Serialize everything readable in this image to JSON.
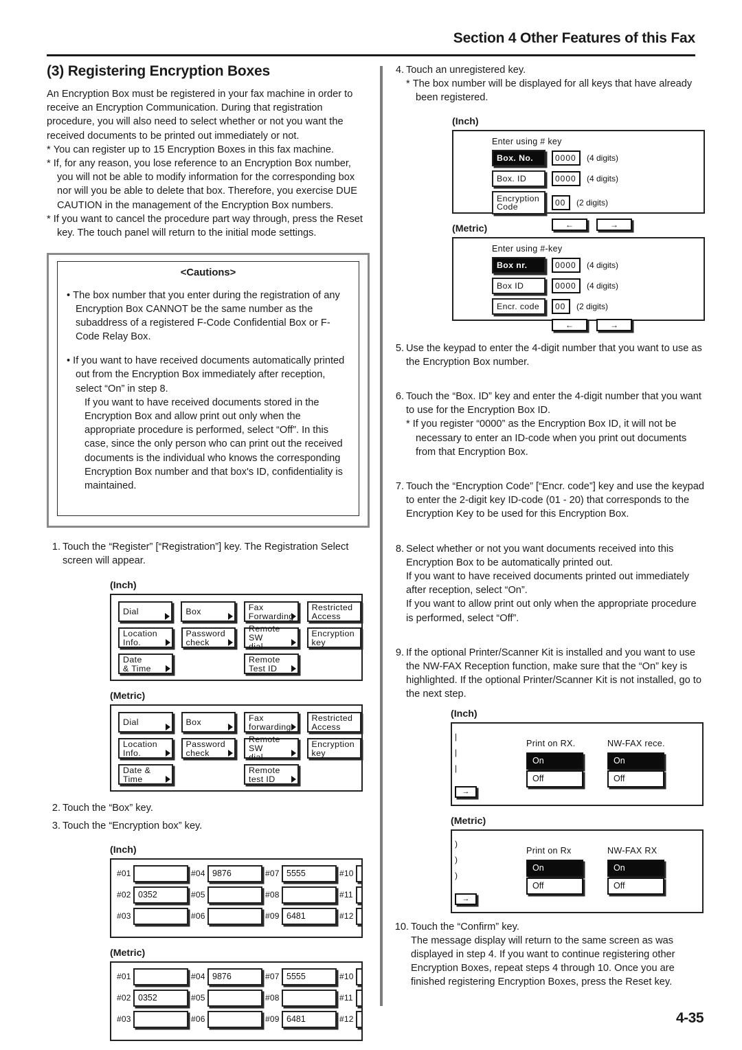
{
  "header": {
    "section_title": "Section 4 Other Features of this Fax"
  },
  "page_number": "4-35",
  "left": {
    "title": "(3) Registering Encryption Boxes",
    "intro": "An Encryption Box must be registered in your fax machine in order to receive an Encryption Communication. During that registration procedure, you will also need to select whether or not you want the received documents to be printed out immediately or not.",
    "notes": [
      "You can register up to 15 Encryption Boxes in this fax machine.",
      "If, for any reason, you lose reference to an Encryption Box number, you will not be able to modify information for the corresponding box nor will you be able to delete that box. Therefore, you exercise DUE CAUTION in the management of the Encryption Box numbers.",
      "If you want to cancel the procedure part way through, press the Reset key. The touch panel will return to the initial mode settings."
    ],
    "cautions": {
      "title": "<Cautions>",
      "items": [
        "The box number that you enter during the registration of any Encryption Box CANNOT be the same number as the subaddress of a registered F-Code Confidential Box or F-Code Relay Box.",
        "If you want to have received documents automatically printed out from the Encryption Box immediately after reception, select “On” in step 8.",
        "If you want to have received documents stored in the Encryption Box and allow print out only when the appropriate procedure is performed, select “Off”. In this case, since the only person who can print out the received documents is the individual who knows the corresponding Encryption Box number and that box's ID, confidentiality is maintained."
      ]
    },
    "steps": [
      {
        "num": "1.",
        "text": "Touch the “Register” [“Registration”] key. The Registration Select screen will appear."
      },
      {
        "num": "2.",
        "text": "Touch the “Box” key."
      },
      {
        "num": "3.",
        "text": "Touch the “Encryption box” key."
      }
    ],
    "reg_select_figs": [
      {
        "label": "(Inch)",
        "rows": [
          [
            {
              "text": "Dial",
              "arrow": true
            },
            {
              "text": "Box",
              "arrow": true
            },
            {
              "text": "Fax\nForwarding",
              "arrow": true
            },
            {
              "text": "Restricted\nAccess",
              "arrow": false
            }
          ],
          [
            {
              "text": "Location\nInfo.",
              "arrow": true
            },
            {
              "text": "Password\ncheck",
              "arrow": true
            },
            {
              "text": "Remote SW\ndial",
              "arrow": true
            },
            {
              "text": "Encryption\nkey",
              "arrow": false
            }
          ],
          [
            {
              "text": "Date\n& Time",
              "arrow": true
            },
            {
              "text": "",
              "blank": true
            },
            {
              "text": "Remote\nTest ID",
              "arrow": true
            },
            {
              "text": "",
              "blank": true
            }
          ]
        ]
      },
      {
        "label": "(Metric)",
        "rows": [
          [
            {
              "text": "Dial",
              "arrow": true
            },
            {
              "text": "Box",
              "arrow": true
            },
            {
              "text": "Fax\nforwarding",
              "arrow": true
            },
            {
              "text": "Restricted\nAccess",
              "arrow": false
            }
          ],
          [
            {
              "text": "Location\nInfo.",
              "arrow": true
            },
            {
              "text": "Password\ncheck",
              "arrow": true
            },
            {
              "text": "Remote SW\ndial",
              "arrow": true
            },
            {
              "text": "Encryption\nkey",
              "arrow": false
            }
          ],
          [
            {
              "text": "Date &\nTime",
              "arrow": true
            },
            {
              "text": "",
              "blank": true
            },
            {
              "text": "Remote\ntest ID",
              "arrow": true
            },
            {
              "text": "",
              "blank": true
            }
          ]
        ]
      }
    ],
    "box_grid_figs": [
      {
        "label": "(Inch)",
        "rows": [
          [
            {
              "key": "#01",
              "value": ""
            },
            {
              "key": "#04",
              "value": "9876"
            },
            {
              "key": "#07",
              "value": "5555"
            },
            {
              "key": "#10",
              "value": ""
            }
          ],
          [
            {
              "key": "#02",
              "value": "0352"
            },
            {
              "key": "#05",
              "value": ""
            },
            {
              "key": "#08",
              "value": ""
            },
            {
              "key": "#11",
              "value": ""
            }
          ],
          [
            {
              "key": "#03",
              "value": ""
            },
            {
              "key": "#06",
              "value": ""
            },
            {
              "key": "#09",
              "value": "6481"
            },
            {
              "key": "#12",
              "value": ""
            }
          ]
        ]
      },
      {
        "label": "(Metric)",
        "rows": [
          [
            {
              "key": "#01",
              "value": ""
            },
            {
              "key": "#04",
              "value": "9876"
            },
            {
              "key": "#07",
              "value": "5555"
            },
            {
              "key": "#10",
              "value": ""
            }
          ],
          [
            {
              "key": "#02",
              "value": "0352"
            },
            {
              "key": "#05",
              "value": ""
            },
            {
              "key": "#08",
              "value": ""
            },
            {
              "key": "#11",
              "value": ""
            }
          ],
          [
            {
              "key": "#03",
              "value": ""
            },
            {
              "key": "#06",
              "value": ""
            },
            {
              "key": "#09",
              "value": "6481"
            },
            {
              "key": "#12",
              "value": ""
            }
          ]
        ]
      }
    ]
  },
  "right": {
    "steps": {
      "s4": {
        "num": "4.",
        "text": "Touch an unregistered key.",
        "sub": "The box number will be displayed for all keys that have already been registered."
      },
      "s5": {
        "num": "5.",
        "text": "Use the keypad to enter the 4-digit number that you want to use as the Encryption Box number."
      },
      "s6": {
        "num": "6.",
        "text": "Touch the “Box. ID” key and enter the 4-digit number that you want to use for the Encryption Box ID.",
        "sub": "If you register “0000” as the Encryption Box ID, it will not be necessary to enter an ID-code when you print out documents from that Encryption Box."
      },
      "s7": {
        "num": "7.",
        "text": "Touch the “Encryption Code” [“Encr. code”] key and use the keypad to enter the 2-digit key ID-code (01 - 20) that corresponds to the Encryption Key to be used for this Encryption Box."
      },
      "s8": {
        "num": "8.",
        "text": "Select whether or not you want documents received into this Encryption Box to be automatically printed out.",
        "line2": "If you want to have received documents printed out immediately after reception, select “On”.",
        "line3": "If you want to allow print out only when the appropriate procedure is performed, select “Off”."
      },
      "s9": {
        "num": "9.",
        "text": "If the optional Printer/Scanner Kit is installed and you want to use the NW-FAX Reception function, make sure that the “On” key is highlighted. If the optional Printer/Scanner Kit is not installed, go to the next step."
      },
      "s10": {
        "num": "10.",
        "text": "Touch the “Confirm” key.",
        "line2": "The message display will return to the same screen as was displayed in step 4. If you want to continue registering other Encryption Boxes, repeat steps 4 through 10. Once you are finished registering Encryption Boxes, press the Reset key."
      }
    },
    "enter_figs": [
      {
        "label": "(Inch)",
        "title": "Enter using # key",
        "rows": [
          {
            "key": "Box. No.",
            "selected": true,
            "value": "0000",
            "digits": "(4 digits)",
            "width": "w4"
          },
          {
            "key": "Box. ID",
            "selected": false,
            "value": "0000",
            "digits": "(4 digits)",
            "width": "w4"
          },
          {
            "key": "Encryption\nCode",
            "selected": false,
            "value": "00",
            "digits": "(2 digits)",
            "width": "w2"
          }
        ],
        "arrows": [
          "←",
          "→"
        ]
      },
      {
        "label": "(Metric)",
        "title": "Enter using #-key",
        "rows": [
          {
            "key": "Box nr.",
            "selected": true,
            "value": "0000",
            "digits": "(4 digits)",
            "width": "w4"
          },
          {
            "key": "Box ID",
            "selected": false,
            "value": "0000",
            "digits": "(4 digits)",
            "width": "w4"
          },
          {
            "key": "Encr. code",
            "selected": false,
            "value": "00",
            "digits": "(2 digits)",
            "width": "w2"
          }
        ],
        "arrows": [
          "←",
          "→"
        ]
      }
    ],
    "onoff_figs": [
      {
        "label": "(Inch)",
        "groups": [
          {
            "caption": "Print on RX.",
            "on": "On",
            "off": "Off",
            "selected": "On"
          },
          {
            "caption": "NW-FAX rece.",
            "on": "On",
            "off": "Off",
            "selected": "On"
          }
        ],
        "arrow": "→"
      },
      {
        "label": "(Metric)",
        "groups": [
          {
            "caption": "Print on Rx",
            "on": "On",
            "off": "Off",
            "selected": "On"
          },
          {
            "caption": "NW-FAX RX",
            "on": "On",
            "off": "Off",
            "selected": "On"
          }
        ],
        "arrow": "→"
      }
    ]
  }
}
